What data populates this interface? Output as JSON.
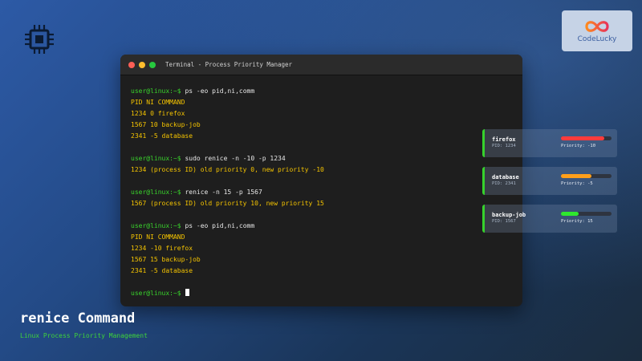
{
  "logo": {
    "text": "CodeLucky",
    "icon": "infinity-logo-icon"
  },
  "icons": {
    "chip": "cpu-chip-icon"
  },
  "terminal": {
    "title": "Terminal - Process Priority Manager",
    "lines": [
      {
        "type": "command",
        "prompt": "user@linux:~$",
        "text": "ps -eo pid,ni,comm"
      },
      {
        "type": "output",
        "text": "PID NI COMMAND"
      },
      {
        "type": "output",
        "text": "1234 0 firefox"
      },
      {
        "type": "output",
        "text": "1567 10 backup-job"
      },
      {
        "type": "output",
        "text": "2341 -5 database"
      },
      {
        "type": "blank"
      },
      {
        "type": "command",
        "prompt": "user@linux:~$",
        "text": "sudo renice -n -10 -p 1234"
      },
      {
        "type": "output",
        "text": "1234 (process ID) old priority 0, new priority -10"
      },
      {
        "type": "blank"
      },
      {
        "type": "command",
        "prompt": "user@linux:~$",
        "text": "renice -n 15 -p 1567"
      },
      {
        "type": "output",
        "text": "1567 (process ID) old priority 10, new priority 15"
      },
      {
        "type": "blank"
      },
      {
        "type": "command",
        "prompt": "user@linux:~$",
        "text": "ps -eo pid,ni,comm"
      },
      {
        "type": "output",
        "text": "PID NI COMMAND"
      },
      {
        "type": "output",
        "text": "1234 -10 firefox"
      },
      {
        "type": "output",
        "text": "1567 15 backup-job"
      },
      {
        "type": "output",
        "text": "2341 -5 database"
      },
      {
        "type": "blank"
      },
      {
        "type": "prompt-cursor",
        "prompt": "user@linux:~$"
      }
    ]
  },
  "processes": [
    {
      "name": "firefox",
      "pid": "PID: 1234",
      "priority": "Priority: -10",
      "bar_fraction": 0.85,
      "bar_color": "#ff3b3b"
    },
    {
      "name": "database",
      "pid": "PID: 2341",
      "priority": "Priority: -5",
      "bar_fraction": 0.6,
      "bar_color": "#ff9f1a"
    },
    {
      "name": "backup-job",
      "pid": "PID: 1567",
      "priority": "Priority: 15",
      "bar_fraction": 0.35,
      "bar_color": "#2ee82e"
    }
  ],
  "headline": {
    "title": "renice Command",
    "subtitle": "Linux Process Priority Management"
  },
  "colors": {
    "prompt": "#39d32c",
    "output": "#f5c400",
    "accent_green": "#36d12c"
  }
}
